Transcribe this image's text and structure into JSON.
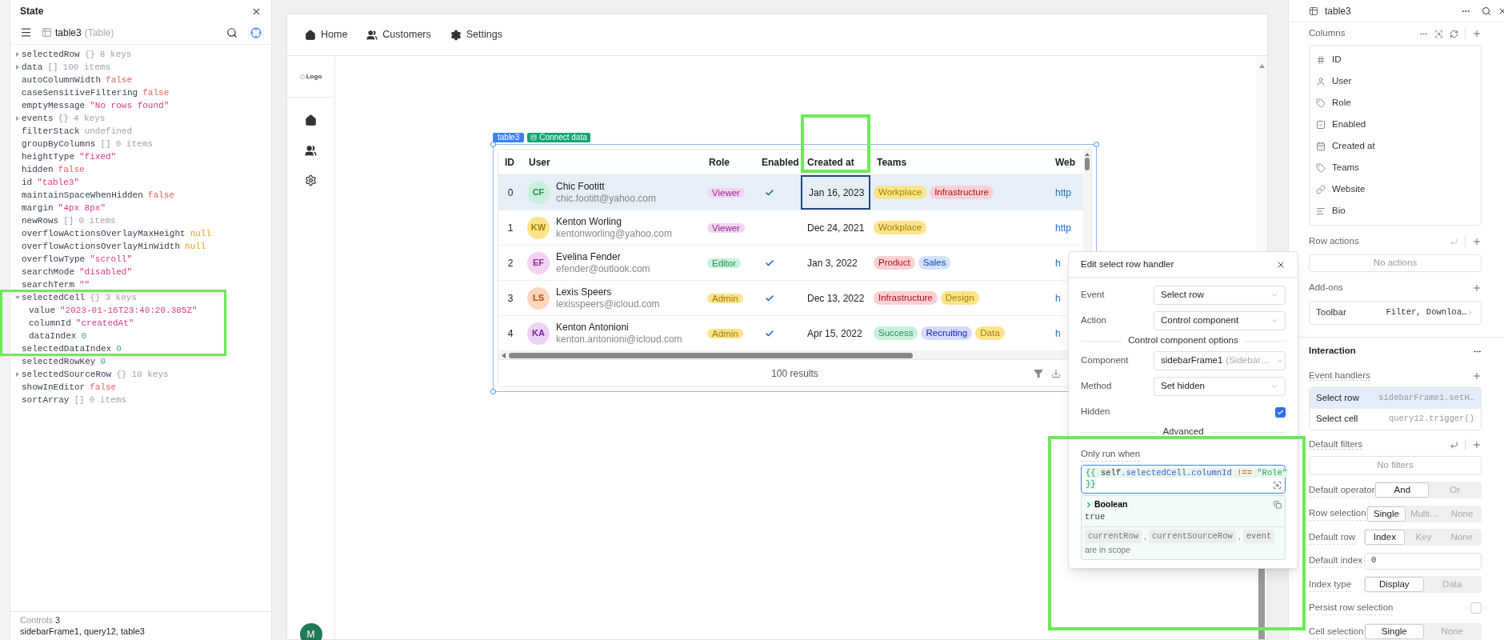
{
  "state_panel": {
    "title": "State",
    "component": "table3",
    "component_type": "(Table)",
    "entries": [
      {
        "key": "selectedRow",
        "value": "{}",
        "meta": "8 keys",
        "kind": "object",
        "expanded": false
      },
      {
        "key": "data",
        "value": "[]",
        "meta": "100 items",
        "kind": "object",
        "expanded": false
      },
      {
        "key": "autoColumnWidth",
        "value": "false",
        "kind": "boolean"
      },
      {
        "key": "caseSensitiveFiltering",
        "value": "false",
        "kind": "boolean"
      },
      {
        "key": "emptyMessage",
        "value": "\"No rows found\"",
        "kind": "string"
      },
      {
        "key": "events",
        "value": "{}",
        "meta": "4 keys",
        "kind": "object",
        "expanded": false
      },
      {
        "key": "filterStack",
        "value": "undefined",
        "kind": "undefined"
      },
      {
        "key": "groupByColumns",
        "value": "[]",
        "meta": "0 items",
        "kind": "object"
      },
      {
        "key": "heightType",
        "value": "\"fixed\"",
        "kind": "string"
      },
      {
        "key": "hidden",
        "value": "false",
        "kind": "boolean"
      },
      {
        "key": "id",
        "value": "\"table3\"",
        "kind": "string"
      },
      {
        "key": "maintainSpaceWhenHidden",
        "value": "false",
        "kind": "boolean"
      },
      {
        "key": "margin",
        "value": "\"4px 8px\"",
        "kind": "string"
      },
      {
        "key": "newRows",
        "value": "[]",
        "meta": "0 items",
        "kind": "object"
      },
      {
        "key": "overflowActionsOverlayMaxHeight",
        "value": "null",
        "kind": "null"
      },
      {
        "key": "overflowActionsOverlayMinWidth",
        "value": "null",
        "kind": "null"
      },
      {
        "key": "overflowType",
        "value": "\"scroll\"",
        "kind": "string"
      },
      {
        "key": "searchMode",
        "value": "\"disabled\"",
        "kind": "string"
      },
      {
        "key": "searchTerm",
        "value": "\"\"",
        "kind": "string"
      },
      {
        "key": "selectedCell",
        "value": "{}",
        "meta": "3 keys",
        "kind": "object",
        "expanded": true,
        "children": [
          {
            "key": "value",
            "value": "\"2023-01-16T23:40:20.385Z\"",
            "kind": "string"
          },
          {
            "key": "columnId",
            "value": "\"createdAt\"",
            "kind": "string"
          },
          {
            "key": "dataIndex",
            "value": "0",
            "kind": "number"
          }
        ]
      },
      {
        "key": "selectedDataIndex",
        "value": "0",
        "kind": "number"
      },
      {
        "key": "selectedRowKey",
        "value": "0",
        "kind": "number"
      },
      {
        "key": "selectedSourceRow",
        "value": "{}",
        "meta": "10 keys",
        "kind": "object",
        "expanded": false
      },
      {
        "key": "showInEditor",
        "value": "false",
        "kind": "boolean"
      },
      {
        "key": "sortArray",
        "value": "[]",
        "meta": "0 items",
        "kind": "object"
      }
    ],
    "footer": {
      "label": "Controls",
      "count": "3",
      "list": "sidebarFrame1, query12, table3"
    }
  },
  "canvas": {
    "nav": [
      {
        "label": "Home",
        "kind": "home"
      },
      {
        "label": "Customers",
        "kind": "users"
      },
      {
        "label": "Settings",
        "kind": "settings"
      }
    ],
    "logo": "Logo",
    "avatar": "M",
    "table": {
      "name": "table3",
      "connect": "Connect data",
      "columns": [
        "ID",
        "User",
        "Role",
        "Enabled",
        "Created at",
        "Teams",
        "Web"
      ],
      "rows": [
        {
          "id": "0",
          "initials": "CF",
          "color": "#c9f0dc",
          "name": "Chic Footitt",
          "email": "chic.footitt@yahoo.com",
          "role": {
            "label": "Viewer",
            "color": "#f2d4f2"
          },
          "enabled": true,
          "created": "Jan 16, 2023",
          "cell_selected": true,
          "teams": [
            {
              "label": "Workplace",
              "color": "#fde48a"
            },
            {
              "label": "Infrastructure",
              "color": "#fbd0d3"
            }
          ],
          "website": "http",
          "selected": true
        },
        {
          "id": "1",
          "initials": "KW",
          "color": "#fde48a",
          "name": "Kenton Worling",
          "email": "kentonworling@yahoo.com",
          "role": {
            "label": "Viewer",
            "color": "#f2d4f2"
          },
          "enabled": false,
          "created": "Dec 24, 2021",
          "cell_selected": false,
          "teams": [
            {
              "label": "Workplace",
              "color": "#fde48a"
            }
          ],
          "website": "http",
          "selected": false
        },
        {
          "id": "2",
          "initials": "EF",
          "color": "#f2d4f2",
          "name": "Evelina Fender",
          "email": "efender@outlook.com",
          "role": {
            "label": "Editor",
            "color": "#c9f0dc"
          },
          "enabled": true,
          "created": "Jan 3, 2022",
          "cell_selected": false,
          "teams": [
            {
              "label": "Product",
              "color": "#fbd0d3"
            },
            {
              "label": "Sales",
              "color": "#d3e1fb"
            }
          ],
          "website": "h",
          "selected": false
        },
        {
          "id": "3",
          "initials": "LS",
          "color": "#fcd6bd",
          "name": "Lexis Speers",
          "email": "lexisspeers@icloud.com",
          "role": {
            "label": "Admin",
            "color": "#fde48a"
          },
          "enabled": true,
          "created": "Dec 13, 2022",
          "cell_selected": false,
          "teams": [
            {
              "label": "Infrastructure",
              "color": "#fbd0d3"
            },
            {
              "label": "Design",
              "color": "#fde48a"
            }
          ],
          "website": "h",
          "selected": false
        },
        {
          "id": "4",
          "initials": "KA",
          "color": "#ecd3f6",
          "name": "Kenton Antonioni",
          "email": "kenton.antonioni@icloud.com",
          "role": {
            "label": "Admin",
            "color": "#fde48a"
          },
          "enabled": true,
          "created": "Apr 15, 2022",
          "cell_selected": false,
          "teams": [
            {
              "label": "Success",
              "color": "#c9f0dc"
            },
            {
              "label": "Recruiting",
              "color": "#d6dafc"
            },
            {
              "label": "Data",
              "color": "#fde48a"
            }
          ],
          "website": "h",
          "selected": false
        }
      ],
      "footer": "100 results"
    }
  },
  "handler_popup": {
    "title": "Edit select row handler",
    "fields": [
      {
        "label": "Event",
        "value": "Select row"
      },
      {
        "label": "Action",
        "value": "Control component"
      }
    ],
    "section": "Control component options",
    "options": [
      {
        "label": "Component",
        "value": "sidebarFrame1",
        "hint": "(Sidebar…"
      },
      {
        "label": "Method",
        "value": "Set hidden"
      }
    ],
    "hidden": {
      "label": "Hidden",
      "checked": true
    },
    "advanced": "Advanced",
    "condition": {
      "label": "Only run when",
      "lines": [
        [
          {
            "kind": "brace",
            "text": "{{"
          },
          {
            "kind": "ident",
            "text": " self"
          },
          {
            "kind": "prop",
            "text": ".selectedCell"
          },
          {
            "kind": "prop",
            "text": ".columnId"
          },
          {
            "kind": "op",
            "text": " !=="
          },
          {
            "kind": "string",
            "text": " \"Role\""
          }
        ],
        [
          {
            "kind": "brace",
            "text": "}}"
          }
        ]
      ]
    },
    "result": {
      "type": "Boolean",
      "value": "true"
    },
    "scope": {
      "chips": [
        "currentRow",
        "currentSourceRow",
        "event"
      ],
      "separator": ",",
      "text": "are in scope"
    }
  },
  "inspector": {
    "title": "table3",
    "columns": {
      "label": "Columns",
      "items": [
        {
          "label": "ID",
          "kind": "number"
        },
        {
          "label": "User",
          "kind": "user"
        },
        {
          "label": "Role",
          "kind": "tag"
        },
        {
          "label": "Enabled",
          "kind": "boolean"
        },
        {
          "label": "Created at",
          "kind": "date"
        },
        {
          "label": "Teams",
          "kind": "tag"
        },
        {
          "label": "Website",
          "kind": "link"
        },
        {
          "label": "Bio",
          "kind": "text"
        }
      ]
    },
    "row_actions": {
      "label": "Row actions",
      "empty": "No actions"
    },
    "addons": {
      "label": "Add-ons",
      "items": [
        {
          "name": "Toolbar",
          "value": "Filter, Downloa…"
        }
      ]
    },
    "interaction": {
      "title": "Interaction",
      "event_handlers": {
        "label": "Event handlers",
        "items": [
          {
            "event": "Select row",
            "action": "sidebarFrame1.setH…",
            "selected": true
          },
          {
            "event": "Select cell",
            "action": "query12.trigger()",
            "selected": false
          }
        ]
      },
      "default_filters": {
        "label": "Default filters",
        "empty": "No filters"
      },
      "settings": [
        {
          "kind": "segmented",
          "label": "Default operator",
          "options": [
            {
              "label": "And",
              "selected": true
            },
            {
              "label": "Or",
              "selected": false
            }
          ]
        },
        {
          "kind": "segmented",
          "label": "Row selection",
          "options": [
            {
              "label": "Single",
              "selected": true
            },
            {
              "label": "Multi…",
              "selected": false
            },
            {
              "label": "None",
              "selected": false
            }
          ]
        },
        {
          "kind": "segmented",
          "label": "Default row",
          "options": [
            {
              "label": "Index",
              "selected": true
            },
            {
              "label": "Key",
              "selected": false
            },
            {
              "label": "None",
              "selected": false
            }
          ]
        },
        {
          "kind": "input",
          "label": "Default index",
          "value": "0"
        },
        {
          "kind": "segmented",
          "label": "Index type",
          "options": [
            {
              "label": "Display",
              "selected": true
            },
            {
              "label": "Data",
              "selected": false
            }
          ]
        },
        {
          "kind": "checkbox",
          "label": "Persist row selection",
          "checked": false
        },
        {
          "kind": "segmented",
          "label": "Cell selection",
          "options": [
            {
              "label": "Single",
              "selected": true
            },
            {
              "label": "None",
              "selected": false
            }
          ]
        }
      ]
    }
  }
}
